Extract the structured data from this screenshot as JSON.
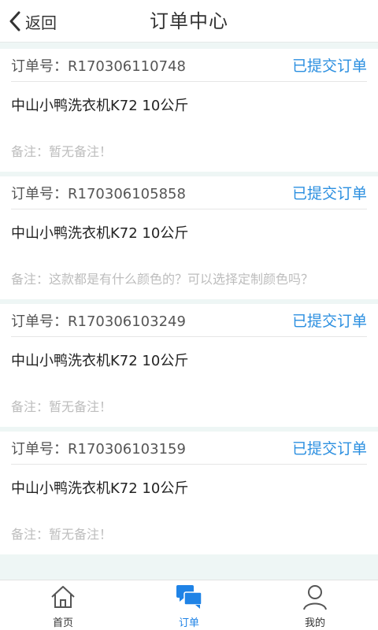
{
  "header": {
    "back_label": "返回",
    "title": "订单中心"
  },
  "order_label_prefix": "订单号：",
  "orders": [
    {
      "order_no": "R170306110748",
      "status": "已提交订单",
      "product": "中山小鸭洗衣机K72 10公斤",
      "note": "备注：暂无备注！"
    },
    {
      "order_no": "R170306105858",
      "status": "已提交订单",
      "product": "中山小鸭洗衣机K72 10公斤",
      "note": "备注：这款都是有什么颜色的？可以选择定制颜色吗？"
    },
    {
      "order_no": "R170306103249",
      "status": "已提交订单",
      "product": "中山小鸭洗衣机K72 10公斤",
      "note": "备注：暂无备注！"
    },
    {
      "order_no": "R170306103159",
      "status": "已提交订单",
      "product": "中山小鸭洗衣机K72 10公斤",
      "note": "备注：暂无备注！"
    }
  ],
  "tabs": [
    {
      "label": "首页",
      "icon": "home-icon"
    },
    {
      "label": "订单",
      "icon": "chat-bubbles-icon",
      "active": true
    },
    {
      "label": "我的",
      "icon": "user-icon"
    }
  ],
  "colors": {
    "accent": "#2b8fe0",
    "background": "#eef6f5"
  }
}
